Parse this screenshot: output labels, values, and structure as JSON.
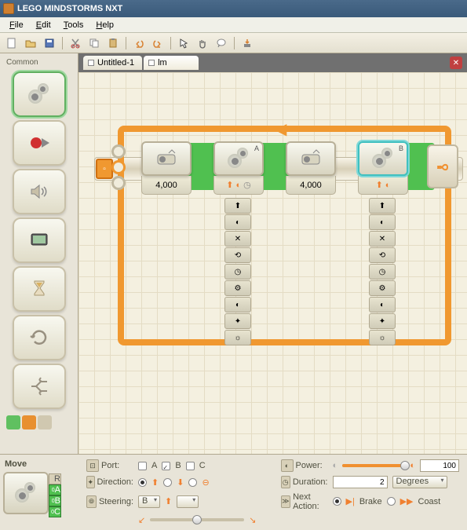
{
  "window": {
    "title": "LEGO MINDSTORMS NXT"
  },
  "menu": {
    "file": "File",
    "edit": "Edit",
    "tools": "Tools",
    "help": "Help"
  },
  "tabs": [
    {
      "label": "Untitled-1",
      "active": false
    },
    {
      "label": "lm",
      "active": true
    }
  ],
  "palette": {
    "label": "Common",
    "items": [
      "move",
      "record-play",
      "sound",
      "display",
      "wait",
      "loop",
      "switch"
    ]
  },
  "canvas": {
    "blocks": [
      {
        "id": "motor1",
        "type": "motor",
        "value": "4,000",
        "port": "",
        "selected": false
      },
      {
        "id": "move1",
        "type": "move",
        "value": "",
        "port": "A",
        "selected": false,
        "hub": true
      },
      {
        "id": "motor2",
        "type": "motor",
        "value": "4,000",
        "port": "",
        "selected": false
      },
      {
        "id": "move2",
        "type": "move",
        "value": "",
        "port": "B",
        "selected": true,
        "hub": true
      }
    ],
    "loop_forever_icon": "infinity"
  },
  "config": {
    "title": "Move",
    "thumb_ports": {
      "r": "R",
      "a": "0",
      "b": "0",
      "c": "0",
      "a_lbl": "A",
      "b_lbl": "B",
      "c_lbl": "C"
    },
    "port": {
      "label": "Port:",
      "a": "A",
      "b": "B",
      "c": "C",
      "a_on": false,
      "b_on": true,
      "c_on": false
    },
    "direction": {
      "label": "Direction:",
      "fwd_on": true,
      "rev_on": false,
      "stop_on": false
    },
    "steering": {
      "label": "Steering:",
      "left": "B",
      "right": "",
      "value": 50
    },
    "power": {
      "label": "Power:",
      "value": "100",
      "slider": 100
    },
    "duration": {
      "label": "Duration:",
      "value": "2",
      "unit": "Degrees"
    },
    "next": {
      "label": "Next Action:",
      "brake": "Brake",
      "coast": "Coast",
      "brake_on": true,
      "coast_on": false
    }
  }
}
